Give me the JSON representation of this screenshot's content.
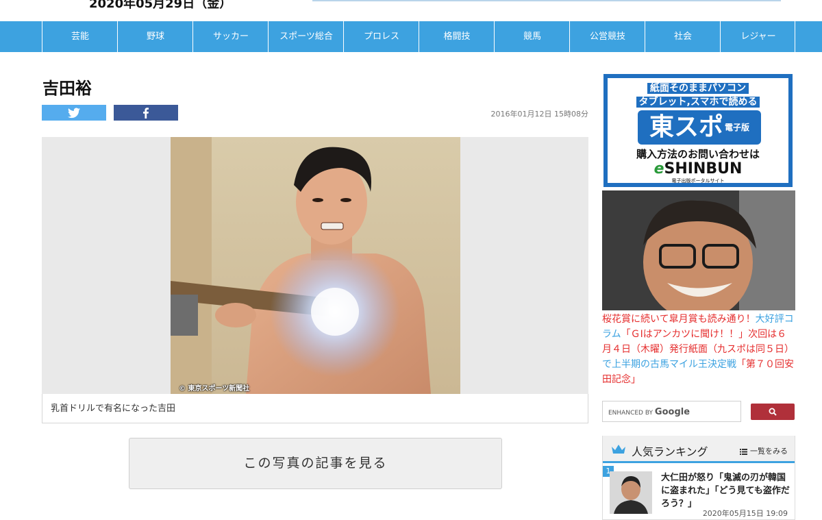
{
  "header": {
    "date": "2020年05月29日（金）"
  },
  "nav": {
    "items": [
      "芸能",
      "野球",
      "サッカー",
      "スポーツ総合",
      "プロレス",
      "格闘技",
      "競馬",
      "公営競技",
      "社会",
      "レジャー"
    ]
  },
  "article": {
    "title": "吉田裕",
    "date": "2016年01月12日 15時08分",
    "photo_credit": "© 東京スポーツ新聞社",
    "caption": "乳首ドリルで有名になった吉田",
    "view_article_label": "この写真の記事を見る"
  },
  "share": {
    "twitter_icon": "twitter-bird-icon",
    "facebook_icon": "facebook-f-icon",
    "twitter_color": "#55acee",
    "facebook_color": "#3b5998"
  },
  "sidebar": {
    "ad": {
      "line1": "紙面そのままパソコン",
      "line2": "タブレット,スマホで読める",
      "logo": "東スポ",
      "logo_sub": "電子版",
      "line3": "購入方法のお問い合わせは",
      "brand": "SHINBUN",
      "brand_prefix": "e",
      "tagline": "電子出版ポータルサイト"
    },
    "promo": {
      "part1": "桜花賞に続いて皐月賞も読み通り！",
      "part2": "大好評コラム「ＧⅠはアンカツに聞け！！」",
      "part3": "次回は６月４日（木曜）発行紙面（九スポは同５日）",
      "part4": "で上半期の古馬マイル王決定戦",
      "part5": "「第７０回安田記念」"
    },
    "search": {
      "enhanced_by": "ENHANCED BY",
      "google": "Google"
    },
    "ranking": {
      "title": "人気ランキング",
      "more_label": "一覧をみる",
      "items": [
        {
          "rank": "1",
          "text": "大仁田が怒り「鬼滅の刃が韓国に盗まれた」「どう見ても盗作だろう？」",
          "date": "2020年05月15日 19:09"
        }
      ]
    }
  },
  "colors": {
    "nav": "#3da2e0",
    "accent_red": "#e52d2d",
    "accent_blue": "#3aa1e0",
    "search_button": "#b0303a"
  }
}
